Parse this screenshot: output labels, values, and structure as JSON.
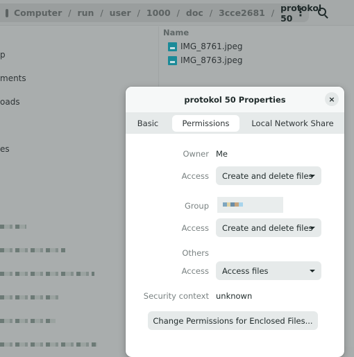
{
  "pathbar": {
    "segments": [
      "Computer",
      "run",
      "user",
      "1000",
      "doc",
      "3cce2681"
    ],
    "current": "protokol 50"
  },
  "sidebar": {
    "items": [
      "p",
      "ments",
      "oads",
      "es"
    ]
  },
  "files": {
    "column": "Name",
    "items": [
      "IMG_8761.jpeg",
      "IMG_8763.jpeg"
    ]
  },
  "dialog": {
    "title": "protokol 50 Properties",
    "close": "×",
    "tabs": [
      "Basic",
      "Permissions",
      "Local Network Share"
    ],
    "active_tab": "Permissions",
    "owner_label": "Owner",
    "owner_value": "Me",
    "access_label": "Access",
    "owner_access": "Create and delete files",
    "group_label": "Group",
    "group_access": "Create and delete files",
    "others_label": "Others",
    "others_access": "Access files",
    "security_label": "Security context",
    "security_value": "unknown",
    "enclosed_button": "Change Permissions for Enclosed Files..."
  }
}
